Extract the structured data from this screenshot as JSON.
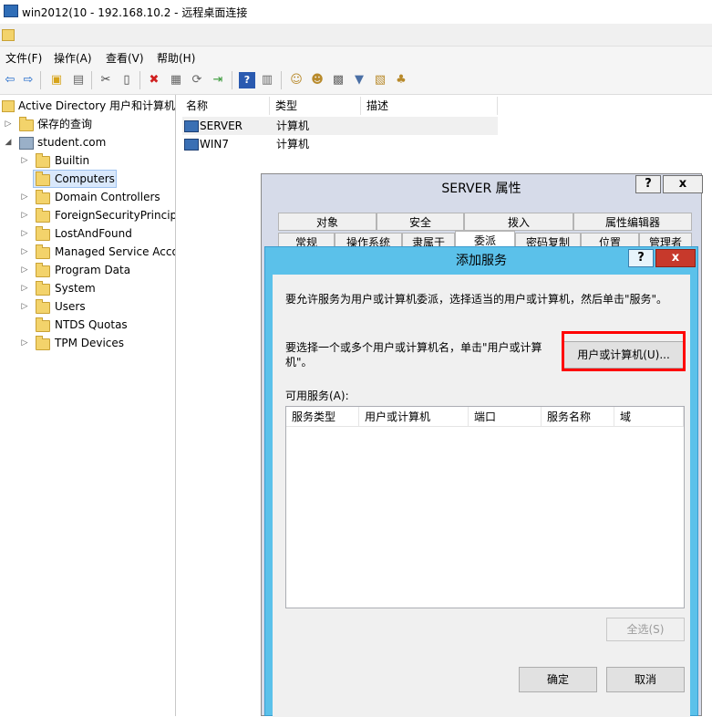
{
  "window": {
    "title": "win2012(10 - 192.168.10.2 - 远程桌面连接"
  },
  "menu": {
    "items": [
      "文件(F)",
      "操作(A)",
      "查看(V)",
      "帮助(H)"
    ]
  },
  "toolbar": {
    "icons": [
      "back-arrow-icon",
      "forward-arrow-icon",
      "up-folder-icon",
      "console-tree-icon",
      "cut-icon",
      "copy-icon",
      "delete-icon",
      "properties-icon",
      "refresh-icon",
      "export-icon",
      "help-icon",
      "show-action-pane-icon",
      "new-user-icon",
      "new-group-icon",
      "new-ou-icon",
      "filter-icon",
      "find-icon",
      "add-to-group-icon"
    ]
  },
  "tree": {
    "root": "Active Directory 用户和计算机",
    "saved_queries": "保存的查询",
    "domain": "student.com",
    "children": [
      "Builtin",
      "Computers",
      "Domain Controllers",
      "ForeignSecurityPrincipa",
      "LostAndFound",
      "Managed Service Acco",
      "Program Data",
      "System",
      "Users",
      "NTDS Quotas",
      "TPM Devices"
    ],
    "selected": "Computers"
  },
  "list": {
    "columns": [
      "名称",
      "类型",
      "描述"
    ],
    "rows": [
      {
        "name": "SERVER",
        "type": "计算机"
      },
      {
        "name": "WIN7",
        "type": "计算机"
      }
    ]
  },
  "properties_dialog": {
    "title": "SERVER 属性",
    "help_btn": "?",
    "close_btn": "x",
    "tabs_row1": [
      "对象",
      "安全",
      "拨入",
      "属性编辑器"
    ],
    "tabs_row2": [
      "常规",
      "操作系统",
      "隶属于",
      "委派",
      "密码复制",
      "位置",
      "管理者"
    ],
    "active_tab": "委派"
  },
  "add_service_dialog": {
    "title": "添加服务",
    "help_btn": "?",
    "close_btn": "x",
    "instruction": "要允许服务为用户或计算机委派，选择适当的用户或计算机，然后单击\"服务\"。",
    "select_text": "要选择一个或多个用户或计算机名，单击\"用户或计算机\"。",
    "user_computer_button": "用户或计算机(U)...",
    "available_label": "可用服务(A):",
    "columns": [
      "服务类型",
      "用户或计算机",
      "端口",
      "服务名称",
      "域"
    ],
    "select_all_button": "全选(S)",
    "ok_button": "确定",
    "cancel_button": "取消"
  },
  "colors": {
    "dialog_accent": "#5bc1ea",
    "highlight": "#ff0000"
  }
}
